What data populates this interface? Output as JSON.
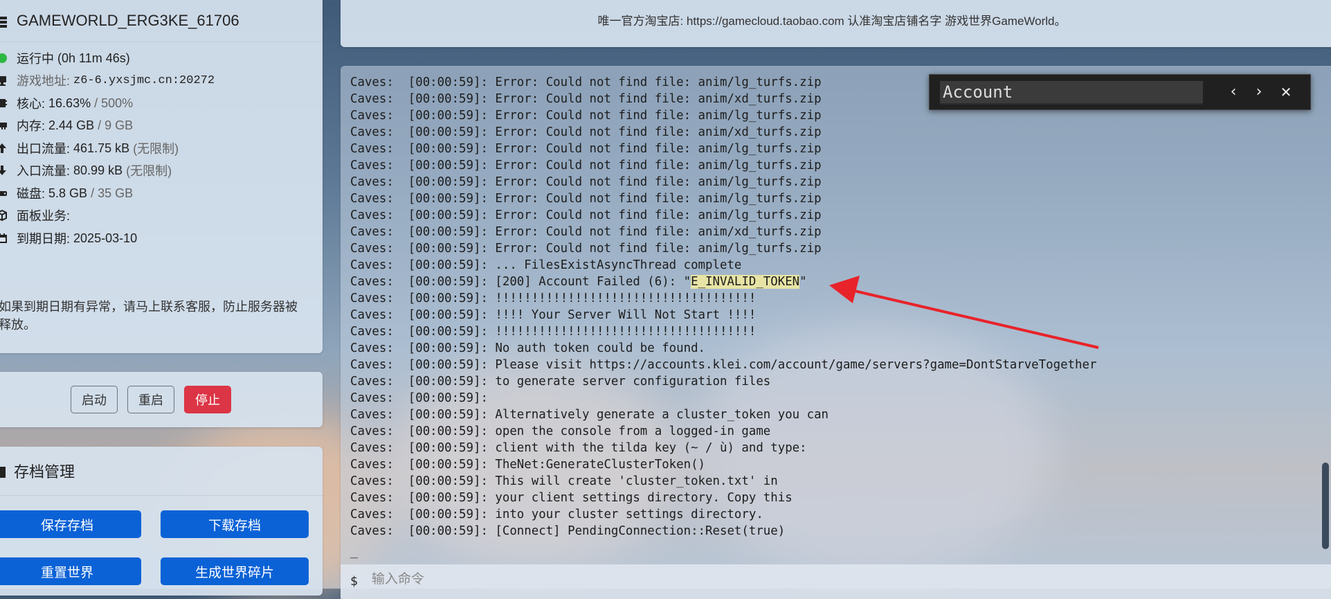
{
  "server": {
    "name": "GAMEWORLD_ERG3KE_61706",
    "status": "运行中",
    "uptime": "(0h 11m 46s)",
    "address_label": "游戏地址:",
    "address": "z6-6.yxsjmc.cn:20272",
    "cpu_label": "核心:",
    "cpu_value": "16.63%",
    "cpu_max": "/ 500%",
    "mem_label": "内存:",
    "mem_value": "2.44 GB",
    "mem_max": "/ 9 GB",
    "out_label": "出口流量:",
    "out_value": "461.75 kB",
    "out_limit": "(无限制)",
    "in_label": "入口流量:",
    "in_value": "80.99 kB",
    "in_limit": "(无限制)",
    "disk_label": "磁盘:",
    "disk_value": "5.8 GB",
    "disk_max": "/ 35 GB",
    "panel_biz_label": "面板业务:",
    "expire_label": "到期日期:",
    "expire_value": "2025-03-10",
    "notice": "如果到期日期有异常，请马上联系客服，防止服务器被释放。",
    "status_color": "#2db843"
  },
  "controls": {
    "start": "启动",
    "restart": "重启",
    "stop": "停止"
  },
  "archive": {
    "title": "存档管理",
    "save": "保存存档",
    "download": "下载存档",
    "reset": "重置世界",
    "fragment": "生成世界碎片"
  },
  "shop_notice": {
    "text": "唯一官方淘宝店: https://gamecloud.taobao.com 认准淘宝店铺名字 游戏世界GameWorld。"
  },
  "console": {
    "lines": [
      "Caves:  [00:00:59]: Error: Could not find file: anim/lg_turfs.zip",
      "Caves:  [00:00:59]: Error: Could not find file: anim/xd_turfs.zip",
      "Caves:  [00:00:59]: Error: Could not find file: anim/lg_turfs.zip",
      "Caves:  [00:00:59]: Error: Could not find file: anim/xd_turfs.zip",
      "Caves:  [00:00:59]: Error: Could not find file: anim/lg_turfs.zip",
      "Caves:  [00:00:59]: Error: Could not find file: anim/lg_turfs.zip",
      "Caves:  [00:00:59]: Error: Could not find file: anim/lg_turfs.zip",
      "Caves:  [00:00:59]: Error: Could not find file: anim/lg_turfs.zip",
      "Caves:  [00:00:59]: Error: Could not find file: anim/lg_turfs.zip",
      "Caves:  [00:00:59]: Error: Could not find file: anim/xd_turfs.zip",
      "Caves:  [00:00:59]: Error: Could not find file: anim/lg_turfs.zip",
      "Caves:  [00:00:59]: ... FilesExistAsyncThread complete",
      "Caves:  [00:00:59]: [200] Account Failed (6): \"E_INVALID_TOKEN\"",
      "Caves:  [00:00:59]: !!!!!!!!!!!!!!!!!!!!!!!!!!!!!!!!!!!!",
      "Caves:  [00:00:59]: !!!! Your Server Will Not Start !!!!",
      "Caves:  [00:00:59]: !!!!!!!!!!!!!!!!!!!!!!!!!!!!!!!!!!!!",
      "Caves:  [00:00:59]: No auth token could be found.",
      "Caves:  [00:00:59]: Please visit https://accounts.klei.com/account/game/servers?game=DontStarveTogether",
      "Caves:  [00:00:59]: to generate server configuration files",
      "Caves:  [00:00:59]:",
      "Caves:  [00:00:59]: Alternatively generate a cluster_token you can",
      "Caves:  [00:00:59]: open the console from a logged-in game",
      "Caves:  [00:00:59]: client with the tilda key (~ / ù) and type:",
      "Caves:  [00:00:59]: TheNet:GenerateClusterToken()",
      "Caves:  [00:00:59]: This will create 'cluster_token.txt' in",
      "Caves:  [00:00:59]: your client settings directory. Copy this",
      "Caves:  [00:00:59]: into your cluster settings directory.",
      "Caves:  [00:00:59]: [Connect] PendingConnection::Reset(true)"
    ],
    "highlight_text": "E_INVALID_TOKEN",
    "cursor": "_",
    "prompt": "$",
    "input_placeholder": "输入命令"
  },
  "find_bar": {
    "query": "Account",
    "prev_icon": "‹",
    "next_icon": "›",
    "close_icon": "✕"
  },
  "colors": {
    "stop_button": "#dc3545",
    "primary_button": "#0b62d6",
    "highlight": "#e7e3a5",
    "annotation_arrow": "#e8232a"
  }
}
